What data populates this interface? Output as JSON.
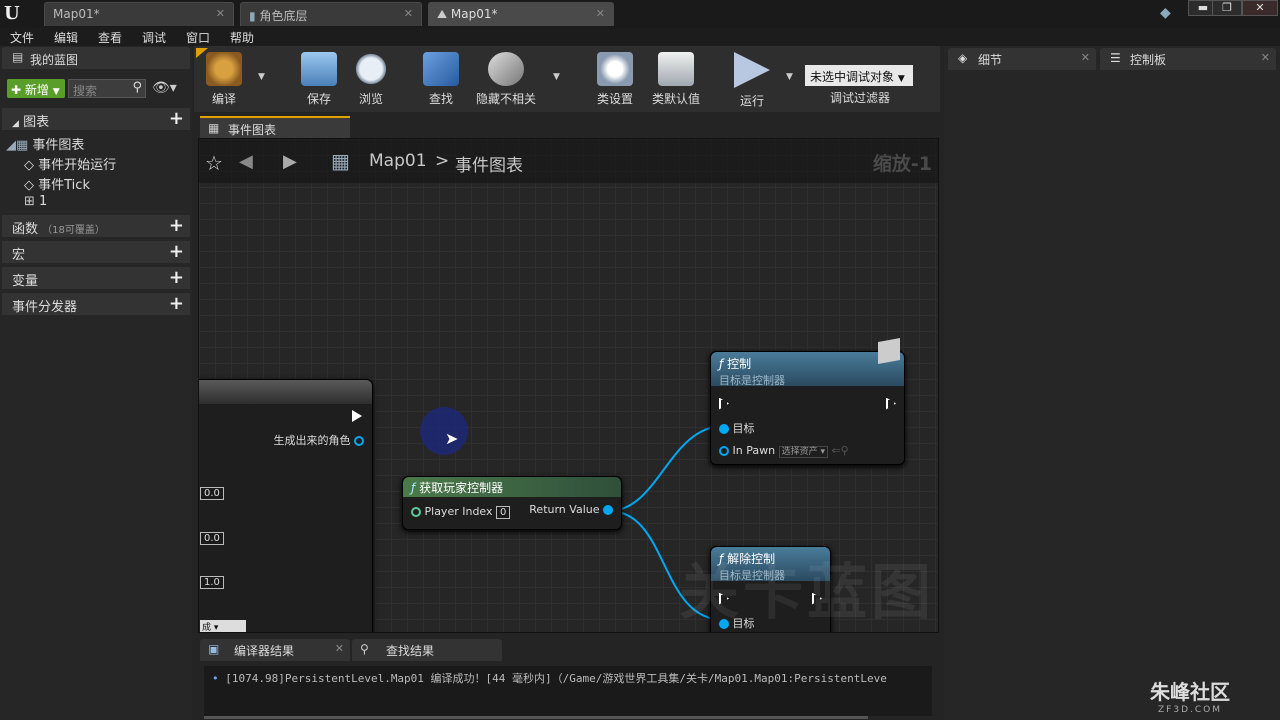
{
  "window": {
    "tabs": [
      {
        "label": "Map01*"
      },
      {
        "label": "角色底层"
      },
      {
        "label": "Map01*"
      }
    ],
    "controls": {
      "minimize": "▬",
      "restore": "❐",
      "close": "✕"
    }
  },
  "menu": [
    "文件",
    "编辑",
    "查看",
    "调试",
    "窗口",
    "帮助"
  ],
  "left_panel": {
    "title": "我的蓝图",
    "new_button": "新增",
    "search_placeholder": "搜索",
    "graph_section": "图表",
    "tree": {
      "root": "事件图表",
      "items": [
        "事件开始运行",
        "事件Tick",
        "1"
      ]
    },
    "sections": [
      {
        "label": "函数",
        "note": "（18可覆盖）"
      },
      {
        "label": "宏",
        "note": ""
      },
      {
        "label": "变量",
        "note": ""
      },
      {
        "label": "事件分发器",
        "note": ""
      }
    ]
  },
  "toolbar": {
    "compile": "编译",
    "save": "保存",
    "browse": "浏览",
    "find": "查找",
    "hide_unrelated": "隐藏不相关",
    "class_settings": "类设置",
    "class_defaults": "类默认值",
    "run": "运行",
    "debug_select": "未选中调试对象",
    "debug_filter": "调试过滤器"
  },
  "graph": {
    "tab": "事件图表",
    "breadcrumb_root": "Map01",
    "breadcrumb_current": "事件图表",
    "zoom": "缩放-1",
    "watermark": "关卡蓝图",
    "left_node": {
      "pin_label": "生成出来的角色",
      "values": [
        "0.0",
        "0.0",
        "1.0"
      ],
      "dropdown": "成"
    },
    "get_controller_node": {
      "title": "获取玩家控制器",
      "input_label": "Player Index",
      "input_value": "0",
      "output_label": "Return Value"
    },
    "possess_node": {
      "title": "控制",
      "subtitle": "目标是控制器",
      "target": "目标",
      "in_pawn": "In Pawn",
      "asset_select": "选择资产"
    },
    "unpossess_node": {
      "title": "解除控制",
      "subtitle": "目标是控制器",
      "target": "目标"
    }
  },
  "right_panel": {
    "details_tab": "细节",
    "palette_tab": "控制板"
  },
  "bottom": {
    "compiler_tab": "编译器结果",
    "find_tab": "查找结果",
    "log": "[1074.98]PersistentLevel.Map01 编译成功！[44 毫秒内]（/Game/游戏世界工具集/关卡/Map01.Map01:PersistentLeve"
  },
  "brand": {
    "name": "朱峰社区",
    "url": "ZF3D.COM"
  },
  "colors": {
    "accent": "#e0a000",
    "pin_blue": "#00a8f3",
    "new_button": "#5a9e2a",
    "node_function_head": "#3a6a80",
    "node_pure_head": "#4a7a4a"
  }
}
